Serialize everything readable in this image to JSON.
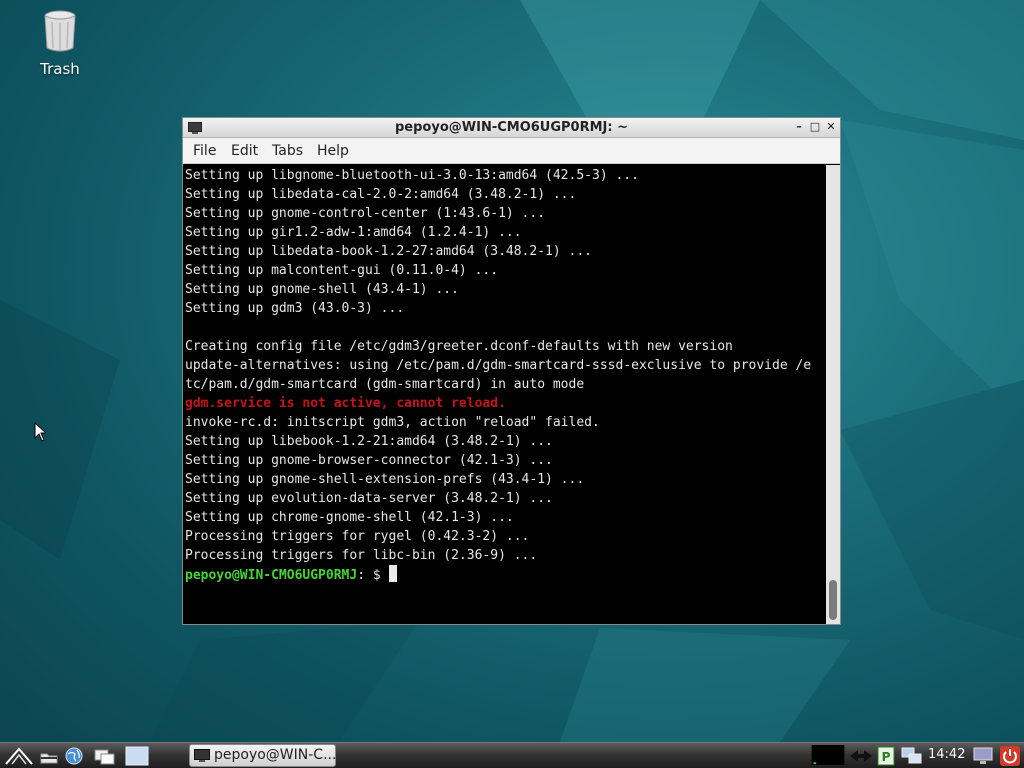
{
  "desktop": {
    "trash_label": "Trash"
  },
  "window": {
    "title": "pepoyo@WIN-CMO6UGP0RMJ: ~",
    "menu": [
      "File",
      "Edit",
      "Tabs",
      "Help"
    ],
    "lines": [
      "Setting up libgnome-bluetooth-ui-3.0-13:amd64 (42.5-3) ...",
      "Setting up libedata-cal-2.0-2:amd64 (3.48.2-1) ...",
      "Setting up gnome-control-center (1:43.6-1) ...",
      "Setting up gir1.2-adw-1:amd64 (1.2.4-1) ...",
      "Setting up libedata-book-1.2-27:amd64 (3.48.2-1) ...",
      "Setting up malcontent-gui (0.11.0-4) ...",
      "Setting up gnome-shell (43.4-1) ...",
      "Setting up gdm3 (43.0-3) ...",
      "",
      "Creating config file /etc/gdm3/greeter.dconf-defaults with new version",
      "update-alternatives: using /etc/pam.d/gdm-smartcard-sssd-exclusive to provide /e",
      "tc/pam.d/gdm-smartcard (gdm-smartcard) in auto mode",
      "gdm.service is not active, cannot reload.",
      "invoke-rc.d: initscript gdm3, action \"reload\" failed.",
      "Setting up libebook-1.2-21:amd64 (3.48.2-1) ...",
      "Setting up gnome-browser-connector (42.1-3) ...",
      "Setting up gnome-shell-extension-prefs (43.4-1) ...",
      "Setting up evolution-data-server (3.48.2-1) ...",
      "Setting up chrome-gnome-shell (42.1-3) ...",
      "Processing triggers for rygel (0.42.3-2) ...",
      "Processing triggers for libc-bin (2.36-9) ..."
    ],
    "prompt_user": "pepoyo@WIN-CMO6UGP0RMJ",
    "prompt_tail": ": $ "
  },
  "taskbar": {
    "task_label": "pepoyo@WIN-C...",
    "clock": "14:42"
  },
  "colors": {
    "error": "#c4141a",
    "prompt": "#44d338"
  }
}
